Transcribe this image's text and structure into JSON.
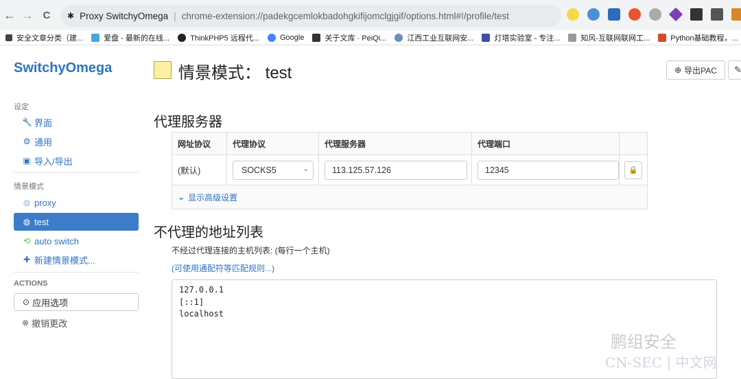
{
  "browser": {
    "tab_title": "Proxy SwitchyOmega",
    "url": "chrome-extension://padekgcemlokbadohgkifijomclgjgif/options.html#!/profile/test",
    "nav": {
      "back": "←",
      "forward": "→",
      "reload": "C"
    },
    "bookmarks": [
      "安全文章分类（建...",
      "爱盘 - 最新的在线...",
      "ThinkPHP5 远程代...",
      "Google",
      "关于文库 · PeiQi...",
      "江西工业互联网安...",
      "灯塔实验室 - 专注...",
      "知风-互联网联网工...",
      "Python基础教程，..."
    ]
  },
  "sidebar": {
    "brand": "SwitchyOmega",
    "section_settings": "设定",
    "settings_items": [
      "界面",
      "通用",
      "导入/导出"
    ],
    "section_profiles": "情景模式",
    "profiles": [
      "proxy",
      "test",
      "auto switch",
      "新建情景模式..."
    ],
    "section_actions": "ACTIONS",
    "apply_label": "应用选项",
    "discard_label": "撤销更改"
  },
  "main": {
    "title": "情景模式： test",
    "export_label": "导出PAC",
    "proxy_heading": "代理服务器",
    "table_headers": [
      "网址协议",
      "代理协议",
      "代理服务器",
      "代理端口"
    ],
    "row_scheme": "(默认)",
    "row_protocol": "SOCKS5",
    "row_server": "113.125.57.126",
    "row_port": "12345",
    "advanced_label": "显示高级设置",
    "bypass_heading": "不代理的地址列表",
    "bypass_desc": "不经过代理连接的主机列表: (每行一个主机)",
    "bypass_link": "(可使用通配符等匹配规则...)",
    "bypass_lines": [
      "127.0.0.1",
      "[::1]",
      "localhost"
    ]
  },
  "watermark": {
    "line1": "鹏组安全",
    "line2": "CN-SEC | 中文网"
  }
}
